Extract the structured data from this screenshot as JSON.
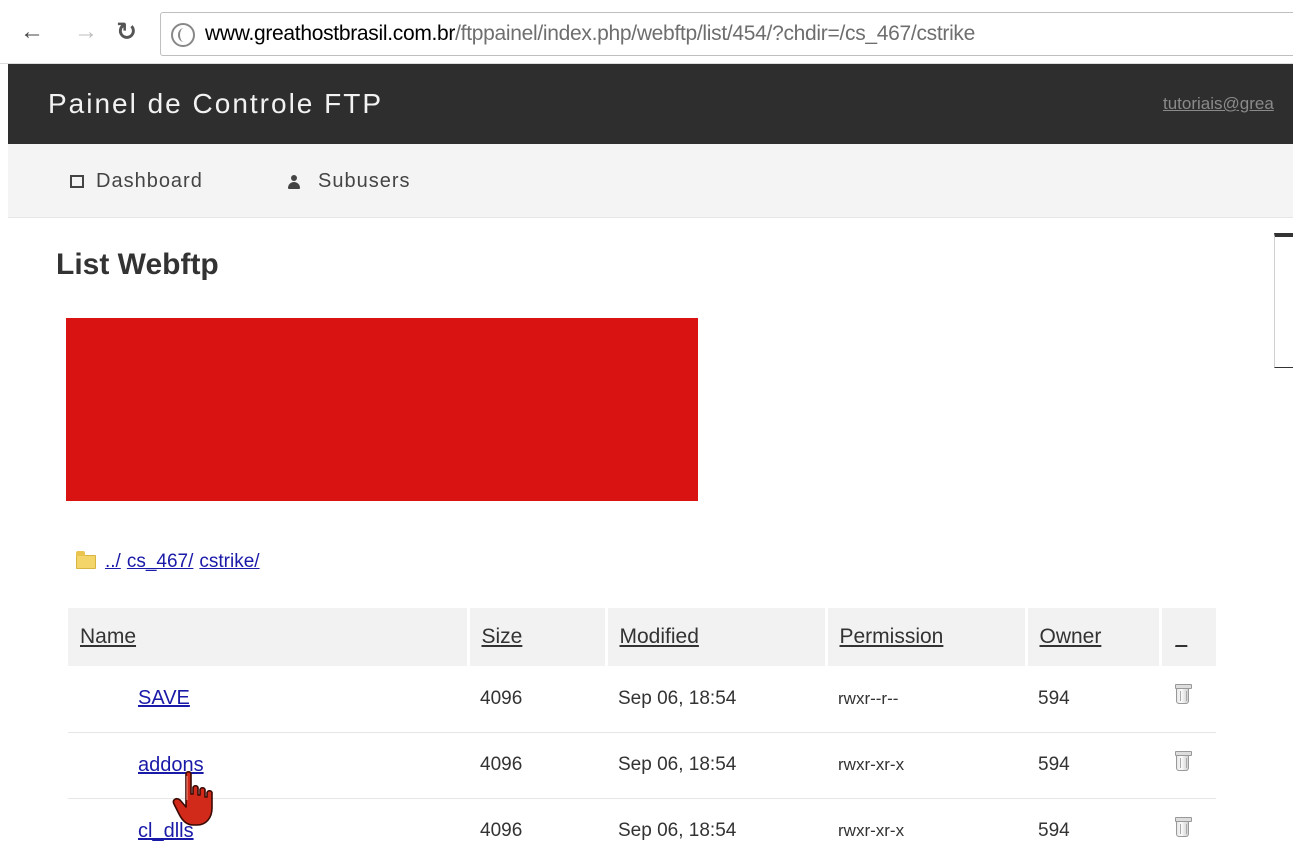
{
  "browser": {
    "url_host": "www.greathostbrasil.com.br",
    "url_path": "/ftppainel/index.php/webftp/list/454/?chdir=/cs_467/cstrike"
  },
  "header": {
    "title": "Painel de Controle FTP",
    "user": "tutoriais@grea"
  },
  "nav": {
    "dashboard": "Dashboard",
    "subusers": "Subusers"
  },
  "page": {
    "title": "List Webftp"
  },
  "breadcrumb": {
    "parts": [
      "../",
      "cs_467/",
      "cstrike/"
    ]
  },
  "table": {
    "headers": {
      "name": "Name",
      "size": "Size",
      "modified": "Modified",
      "permission": "Permission",
      "owner": "Owner",
      "actions": "_"
    },
    "rows": [
      {
        "name": "SAVE",
        "size": "4096",
        "modified": "Sep 06, 18:54",
        "permission": "rwxr--r--",
        "owner": "594"
      },
      {
        "name": "addons",
        "size": "4096",
        "modified": "Sep 06, 18:54",
        "permission": "rwxr-xr-x",
        "owner": "594"
      },
      {
        "name": "cl_dlls",
        "size": "4096",
        "modified": "Sep 06, 18:54",
        "permission": "rwxr-xr-x",
        "owner": "594"
      }
    ]
  },
  "icons": {
    "back": "back-arrow-icon",
    "forward": "forward-arrow-icon",
    "reload": "reload-icon",
    "globe": "globe-icon",
    "dashboard": "square-icon",
    "subusers": "user-icon",
    "folder": "folder-icon",
    "delete": "trash-icon",
    "cursor": "hand-cursor-icon"
  },
  "colors": {
    "header_bg": "#2e2e2e",
    "subnav_bg": "#f4f4f4",
    "link": "#1a1aa8",
    "redacted": "#d91212"
  }
}
